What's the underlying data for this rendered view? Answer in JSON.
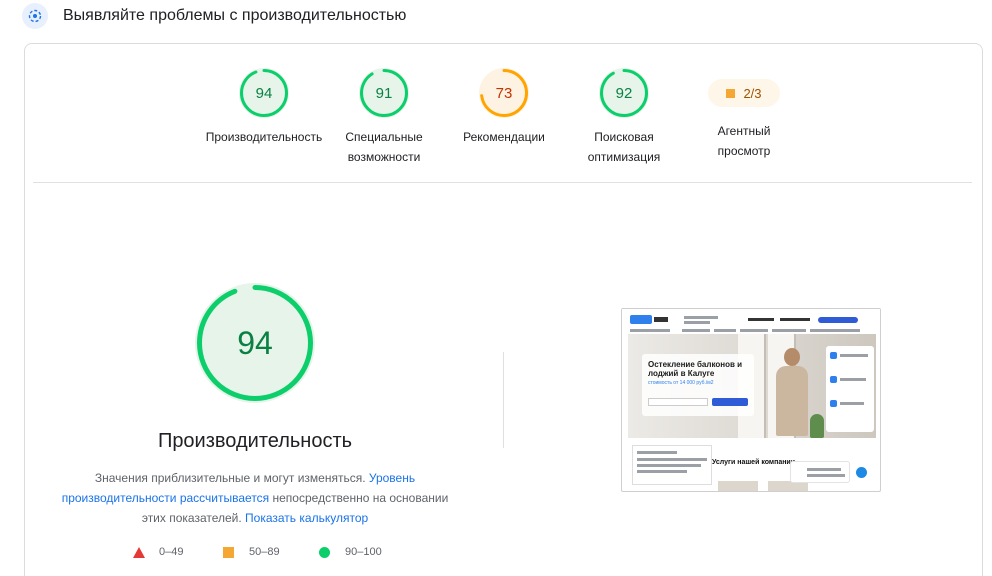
{
  "header": {
    "title": "Выявляйте проблемы с производительностью",
    "icon": "speed-icon"
  },
  "categories": [
    {
      "score": 94,
      "label_line1": "Производительность",
      "label_line2": "",
      "status": "pass",
      "color": "#0cce6b"
    },
    {
      "score": 91,
      "label_line1": "Специальные",
      "label_line2": "возможности",
      "status": "pass",
      "color": "#0cce6b"
    },
    {
      "score": 73,
      "label_line1": "Рекомендации",
      "label_line2": "",
      "status": "average",
      "color": "#ffa400"
    },
    {
      "score": 92,
      "label_line1": "Поисковая",
      "label_line2": "оптимизация",
      "status": "pass",
      "color": "#0cce6b"
    }
  ],
  "agentic": {
    "value": "2/3",
    "label_line1": "Агентный",
    "label_line2": "просмотр",
    "color": "#f4a733"
  },
  "main_gauge": {
    "score": 94,
    "title": "Производительность",
    "color": "#0cce6b"
  },
  "description": {
    "text1": "Значения приблизительные и могут изменяться. ",
    "link1": "Уровень производительности рассчитывается",
    "text2": " непосредственно на основании этих показателей. ",
    "link2": "Показать калькулятор"
  },
  "legend": {
    "fail": "0–49",
    "average": "50–89",
    "pass": "90–100",
    "colors": {
      "fail": "#e53935",
      "average": "#f4a733",
      "pass": "#0cce6b"
    }
  },
  "screenshot": {
    "hero_title": "Остекление балконов и лоджий в Калуге",
    "price": "стоимость от 14 000 руб./м2",
    "section_title": "Услуги нашей компании"
  }
}
